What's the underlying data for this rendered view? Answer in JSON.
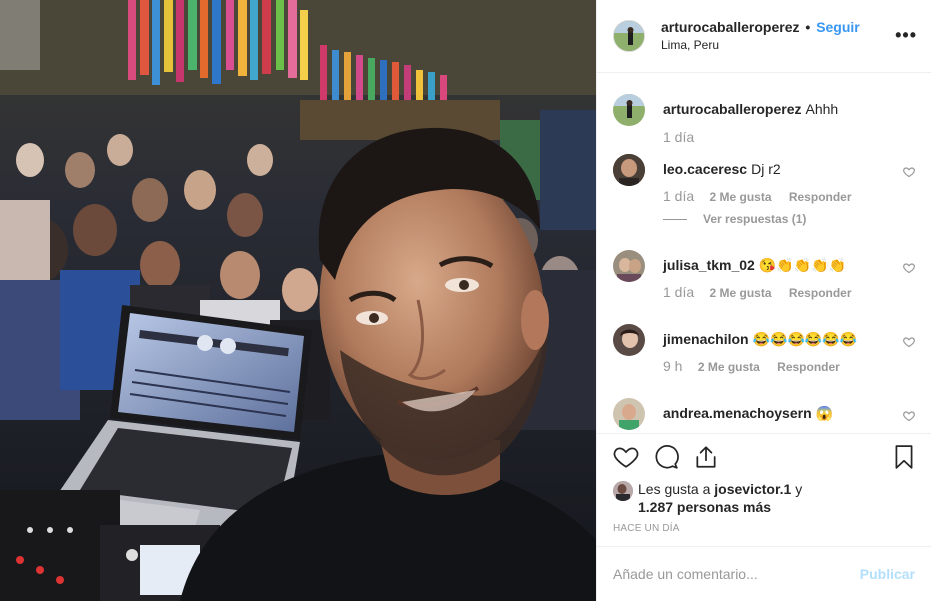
{
  "post": {
    "photo_alt": "selfie",
    "header": {
      "username": "arturocaballeroperez",
      "separator": "•",
      "follow_label": "Seguir",
      "location": "Lima, Peru",
      "more_icon": "more-options-icon"
    },
    "comments": [
      {
        "user": "arturocaballeroperez",
        "text": "Ahhh",
        "time": "1 día",
        "likes": "",
        "reply": "",
        "avatar_color": "#6f9a5a"
      },
      {
        "user": "leo.caceresc",
        "text": "Dj r2",
        "time": "1 día",
        "likes": "2 Me gusta",
        "reply": "Responder",
        "view_replies": "Ver respuestas (1)",
        "avatar_color": "#4a4038"
      },
      {
        "user": "julisa_tkm_02",
        "text": "😘👏👏👏👏",
        "time": "1 día",
        "likes": "2 Me gusta",
        "reply": "Responder",
        "avatar_color": "#8a7f70"
      },
      {
        "user": "jimenachilon",
        "text": "😂😂😂😂😂😂",
        "time": "9 h",
        "likes": "2 Me gusta",
        "reply": "Responder",
        "avatar_color": "#5a4a45"
      },
      {
        "user": "andrea.menachoysern",
        "text": "😱",
        "time": "",
        "likes": "",
        "reply": "",
        "avatar_color": "#b8b0a0"
      }
    ],
    "actions": {
      "like_icon": "heart-icon",
      "comment_icon": "comment-bubble-icon",
      "share_icon": "share-icon",
      "save_icon": "bookmark-icon"
    },
    "likes": {
      "prefix": "Les gusta a ",
      "first_user": "josevictor.1",
      "conjunction": " y",
      "others": "1.287 personas más"
    },
    "time_ago": "HACE UN DÍA",
    "add_comment": {
      "placeholder": "Añade un comentario...",
      "publish_label": "Publicar"
    },
    "colors": {
      "accent": "#3897f0",
      "publish_disabled": "#b2dffc",
      "muted": "#999999",
      "border": "#efefef"
    }
  }
}
